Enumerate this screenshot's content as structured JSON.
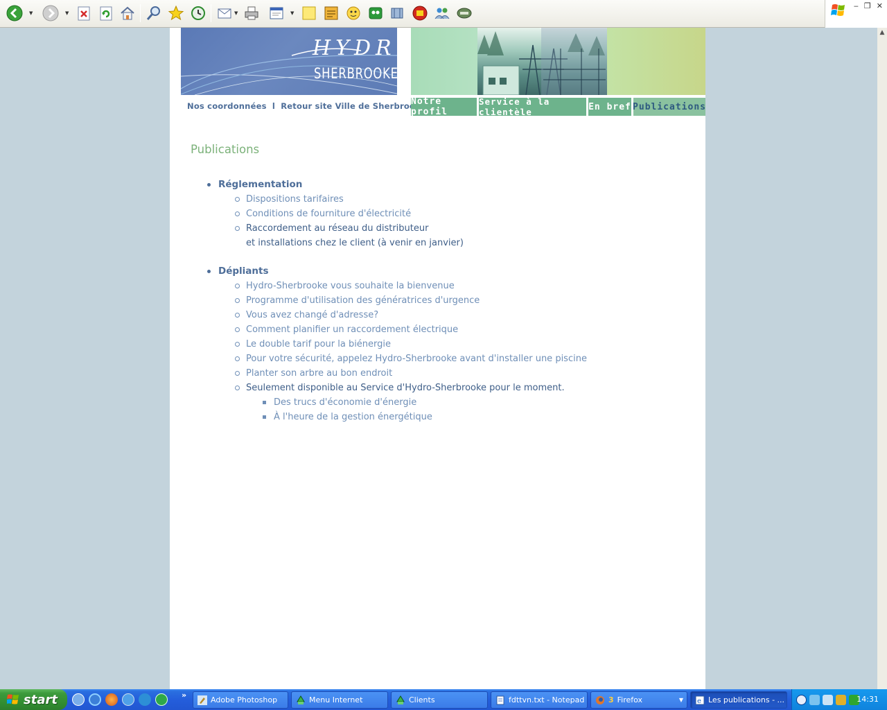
{
  "site": {
    "logo_top": "HYDRO",
    "logo_bottom": "SHERBROOKE",
    "links": [
      "Nos coordonnées",
      "Retour site Ville de Sherbrooke"
    ],
    "link_separator": "l",
    "menu": [
      "Notre profil",
      "Service à la clientèle",
      "En bref",
      "Publications"
    ],
    "active_menu": "Publications"
  },
  "main": {
    "title": "Publications",
    "sections": [
      {
        "label": "Réglementation",
        "items": [
          "Dispositions tarifaires",
          "Conditions de fourniture d'électricité",
          "Raccordement au réseau du distributeur",
          "et installations chez le client (à venir en janvier)"
        ]
      },
      {
        "label": "Dépliants",
        "items": [
          "Hydro-Sherbrooke vous souhaite la bienvenue",
          "Programme d'utilisation des génératrices d'urgence",
          "Vous avez changé d'adresse?",
          "Comment planifier un raccordement électrique",
          "Le double tarif pour la biénergie",
          "Pour votre sécurité, appelez Hydro-Sherbrooke avant d'installer une piscine",
          "Planter son arbre au bon endroit",
          "Seulement disponible au Service d'Hydro-Sherbrooke pour le moment."
        ],
        "subitems": [
          "Des trucs d'économie d'énergie",
          "À l'heure de la gestion énergétique"
        ]
      }
    ]
  },
  "toolbar": {
    "icons": [
      "back-icon",
      "forward-icon",
      "stop-icon",
      "refresh-icon",
      "home-icon",
      "search-icon",
      "favorites-icon",
      "history-icon",
      "mail-icon",
      "print-icon",
      "edit-icon",
      "notes-icon",
      "messenger-icon"
    ]
  },
  "taskbar": {
    "start_label": "start",
    "more": "»",
    "tasks": [
      {
        "label": "Adobe Photoshop",
        "icon": "photoshop-icon"
      },
      {
        "label": "Menu Internet",
        "icon": "recycle-icon"
      },
      {
        "label": "Clients",
        "icon": "recycle-icon"
      },
      {
        "label": "fdttvn.txt - Notepad",
        "icon": "notepad-icon"
      },
      {
        "label": "Firefox",
        "count": "3",
        "icon": "firefox-icon"
      },
      {
        "label": "Les publications - ...",
        "icon": "ie-icon"
      }
    ],
    "clock": "14:31"
  },
  "colors": {
    "page_bg": "#c3d3dc",
    "brand_blue": "#5a79b6",
    "menu_green": "#6db38c",
    "title_green": "#7cb27a",
    "link_blue": "#6f8fb7",
    "dark_blue": "#3e5e88",
    "taskbar_blue": "#245edb",
    "start_green": "#3c9b3c"
  }
}
